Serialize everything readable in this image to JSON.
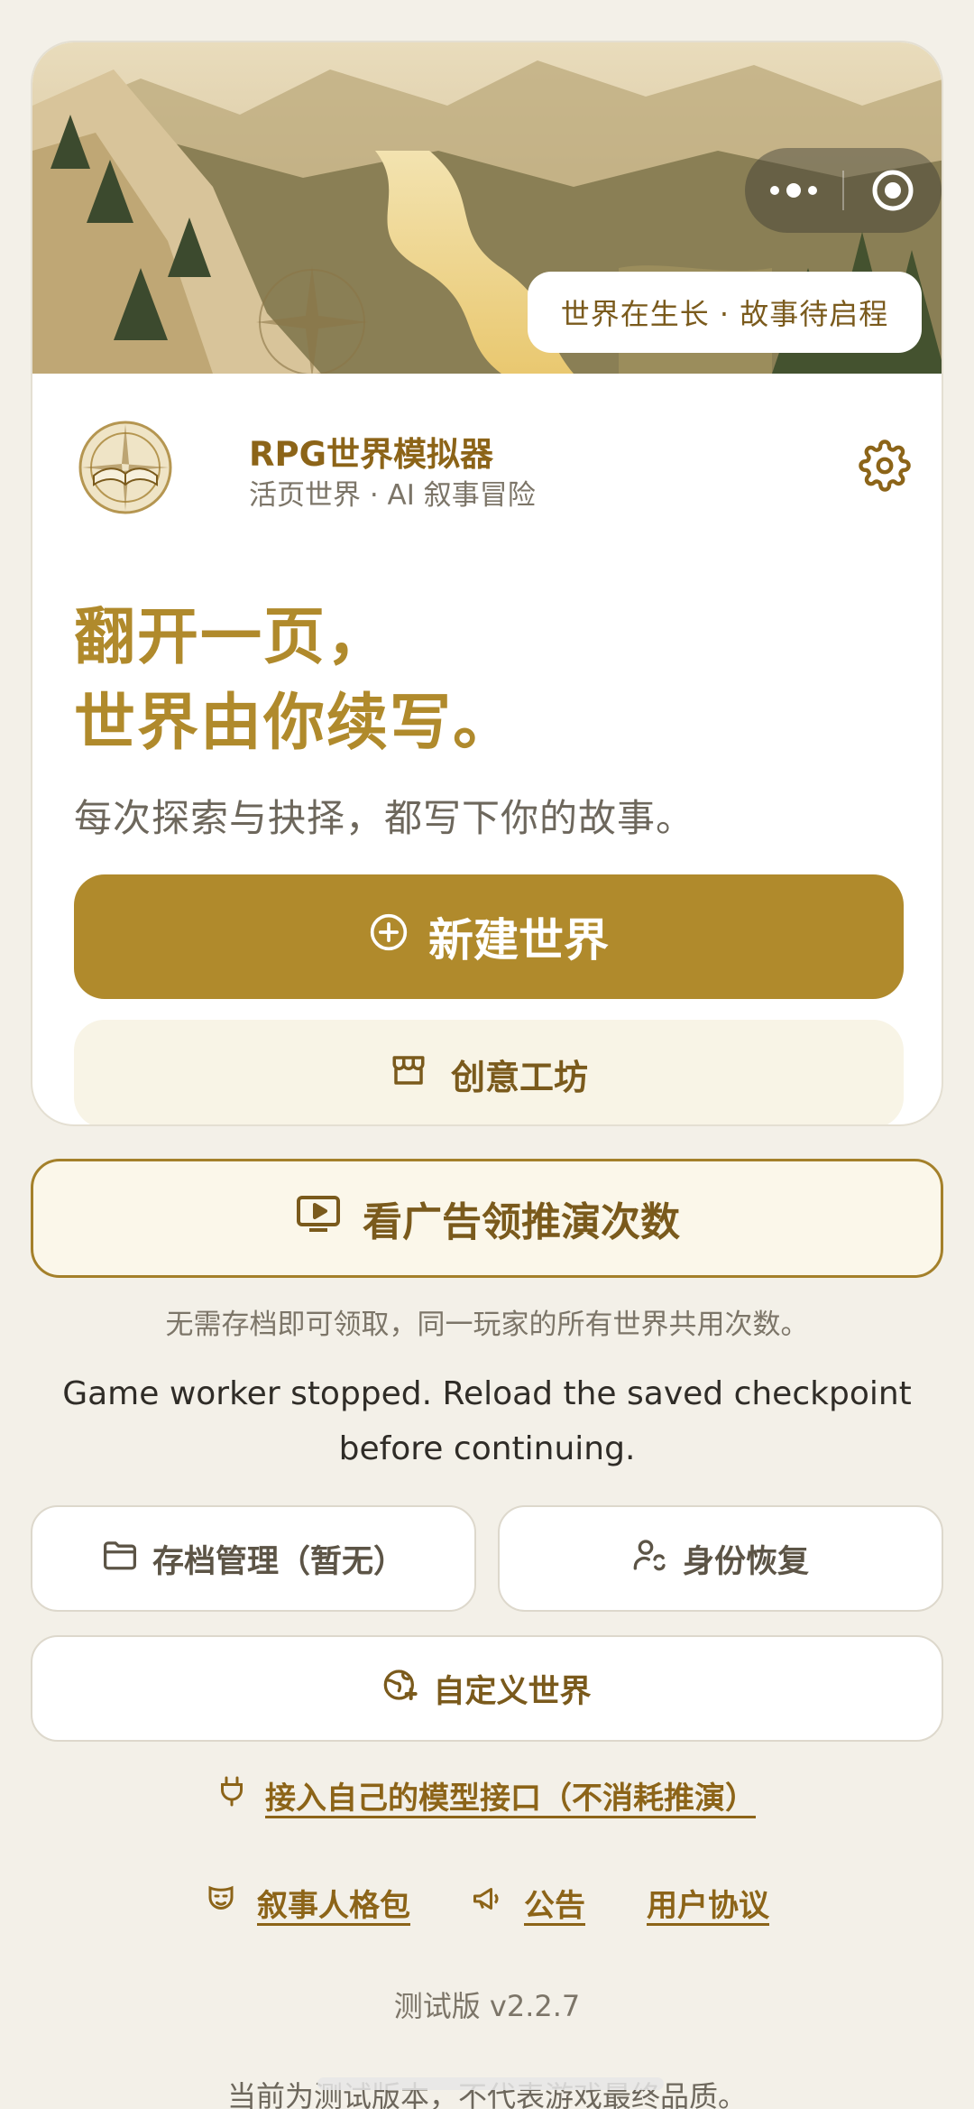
{
  "hero": {
    "tag": "世界在生长 · 故事待启程"
  },
  "capsule": {
    "more_icon": "more-dots-icon",
    "close_icon": "target-circle-icon"
  },
  "brand": {
    "title": "RPG世界模拟器",
    "subtitle": "活页世界 · AI 叙事冒险",
    "settings_icon": "gear-icon"
  },
  "headline": {
    "line1": "翻开一页，",
    "line2": "世界由你续写。"
  },
  "subline": "每次探索与抉择，都写下你的故事。",
  "buttons": {
    "new_world": "新建世界",
    "workshop": "创意工坊",
    "watch_ad": "看广告领推演次数",
    "save_manage": "存档管理（暂无）",
    "identity_restore": "身份恢复",
    "custom_world": "自定义世界"
  },
  "ad_note": "无需存档即可领取，同一玩家的所有世界共用次数。",
  "error": "Game worker stopped. Reload the saved checkpoint before continuing.",
  "links": {
    "own_api": "接入自己的模型接口（不消耗推演）",
    "persona_pack": "叙事人格包",
    "announcement": "公告",
    "user_agreement": "用户协议"
  },
  "version": "测试版 v2.2.7",
  "disclaimer": "当前为测试版本，不代表游戏最终品质。",
  "colors": {
    "accent": "#b08a2c",
    "accent_dark": "#8c6418",
    "background": "#f3f0e8"
  }
}
